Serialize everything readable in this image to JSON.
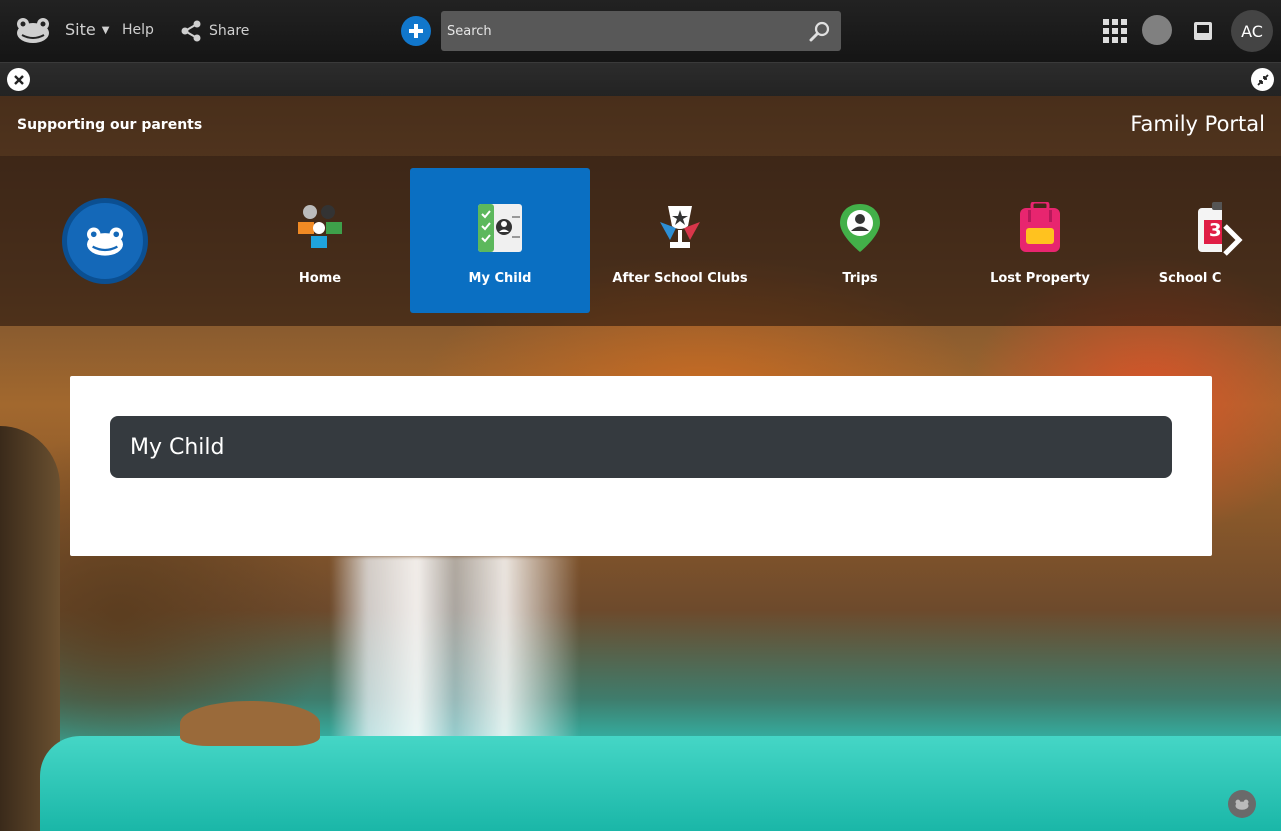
{
  "topbar": {
    "site_label": "Site",
    "help_label": "Help",
    "share_label": "Share",
    "search_placeholder": "Search",
    "avatar_initials": "AC",
    "colors": {
      "plus_button": "#1177cc",
      "search_bg": "#585858"
    }
  },
  "header": {
    "tagline": "Supporting our parents",
    "portal_title": "Family Portal"
  },
  "nav": {
    "items": [
      {
        "label": "Home",
        "icon": "family-people-icon"
      },
      {
        "label": "My Child",
        "icon": "child-checklist-icon",
        "active": true
      },
      {
        "label": "After School Clubs",
        "icon": "trophy-icon"
      },
      {
        "label": "Trips",
        "icon": "map-pin-icon"
      },
      {
        "label": "Lost Property",
        "icon": "backpack-icon"
      },
      {
        "label": "School Calendar",
        "icon": "calendar-icon"
      }
    ],
    "calendar_day": "3",
    "active_color": "#0a6fc2"
  },
  "main": {
    "section_title": "My Child"
  }
}
